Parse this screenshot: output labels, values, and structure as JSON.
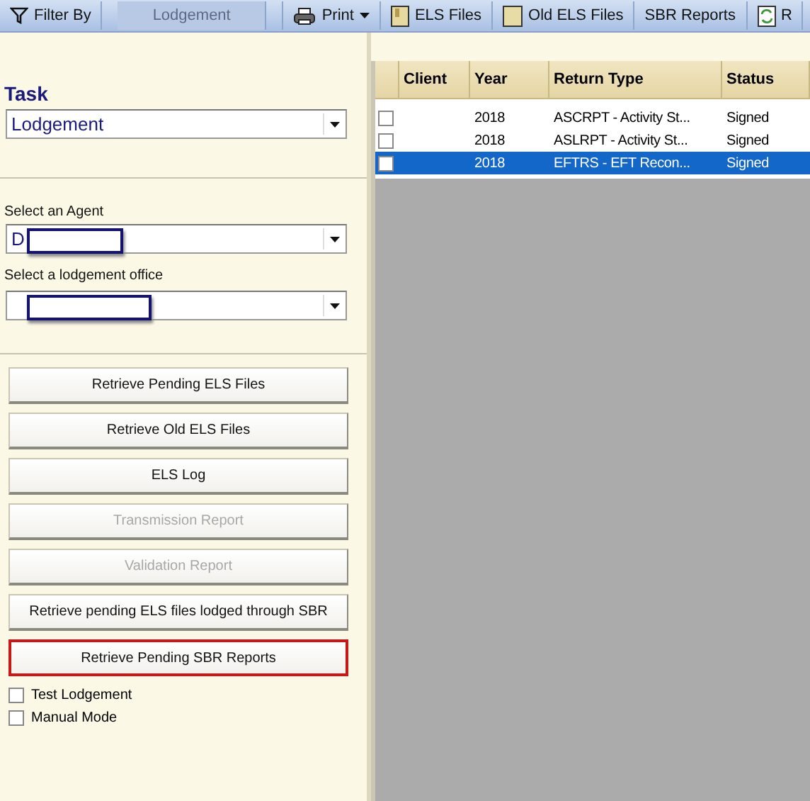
{
  "toolbar": [
    {
      "kind": "button",
      "label": "Filter By"
    },
    {
      "kind": "combo",
      "value": "Lodgement",
      "disabled": true
    },
    {
      "kind": "dropdown",
      "label": "Print"
    },
    {
      "kind": "button",
      "label": "ELS Files"
    },
    {
      "kind": "button",
      "label": "Old ELS Files"
    },
    {
      "kind": "button",
      "label": "SBR Reports"
    },
    {
      "kind": "button",
      "label": "R"
    }
  ],
  "task": {
    "title": "Task",
    "value": "Lodgement"
  },
  "agent": {
    "label": "Select an Agent",
    "value": "D",
    "redacted": true
  },
  "office": {
    "label": "Select a lodgement office",
    "redacted": true
  },
  "buttons": [
    {
      "label": "Retrieve Pending ELS Files",
      "disabled": false,
      "highlighted": false
    },
    {
      "label": "Retrieve Old ELS Files",
      "disabled": false,
      "highlighted": false
    },
    {
      "label": "ELS Log",
      "disabled": false,
      "highlighted": false
    },
    {
      "label": "Transmission Report",
      "disabled": true,
      "highlighted": false
    },
    {
      "label": "Validation Report",
      "disabled": true,
      "highlighted": false
    },
    {
      "label": "Retrieve pending ELS files lodged through SBR",
      "disabled": false,
      "highlighted": false
    },
    {
      "label": "Retrieve Pending SBR Reports",
      "disabled": false,
      "highlighted": true
    }
  ],
  "options": [
    {
      "label": "Test Lodgement",
      "checked": false
    },
    {
      "label": "Manual Mode",
      "checked": false
    }
  ],
  "table": {
    "columns": [
      "Client",
      "Year",
      "Return Type",
      "Status"
    ],
    "rows": [
      {
        "checked": false,
        "selected": false,
        "year": "2018",
        "return_type": "ASCRPT - Activity St...",
        "status": "Signed"
      },
      {
        "checked": false,
        "selected": false,
        "year": "2018",
        "return_type": "ASLRPT - Activity St...",
        "status": "Signed"
      },
      {
        "checked": false,
        "selected": true,
        "year": "2018",
        "return_type": "EFTRS - EFT Recon...",
        "status": "Signed"
      }
    ]
  }
}
